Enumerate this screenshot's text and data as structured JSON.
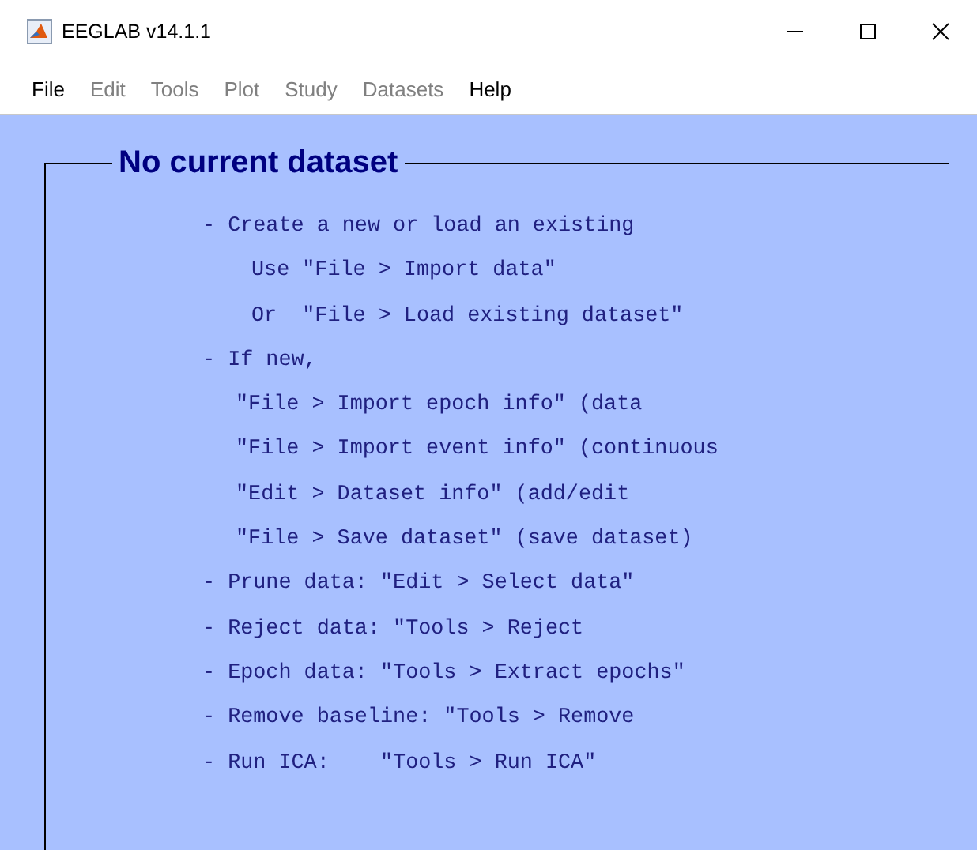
{
  "window": {
    "title": "EEGLAB v14.1.1"
  },
  "menu": [
    {
      "label": "File",
      "disabled": false
    },
    {
      "label": "Edit",
      "disabled": true
    },
    {
      "label": "Tools",
      "disabled": true
    },
    {
      "label": "Plot",
      "disabled": true
    },
    {
      "label": "Study",
      "disabled": true
    },
    {
      "label": "Datasets",
      "disabled": true
    },
    {
      "label": "Help",
      "disabled": false
    }
  ],
  "panel": {
    "title": "No current dataset",
    "lines": [
      {
        "kind": "bullet",
        "text": "- Create a new or load an existing"
      },
      {
        "kind": "option",
        "text": "Use \"File > Import data\""
      },
      {
        "kind": "option",
        "text": "Or  \"File > Load existing dataset\""
      },
      {
        "kind": "bullet",
        "text": "- If new,"
      },
      {
        "kind": "step",
        "text": "\"File > Import epoch info\" (data"
      },
      {
        "kind": "step",
        "text": "\"File > Import event info\" (continuous"
      },
      {
        "kind": "step",
        "text": "\"Edit > Dataset info\" (add/edit"
      },
      {
        "kind": "step",
        "text": "\"File > Save dataset\" (save dataset)"
      },
      {
        "kind": "bullet",
        "text": "- Prune data: \"Edit > Select data\""
      },
      {
        "kind": "bullet",
        "text": "- Reject data: \"Tools > Reject"
      },
      {
        "kind": "bullet",
        "text": "- Epoch data: \"Tools > Extract epochs\""
      },
      {
        "kind": "bullet",
        "text": "- Remove baseline: \"Tools > Remove"
      },
      {
        "kind": "bullet",
        "text": "- Run ICA:    \"Tools > Run ICA\""
      }
    ]
  }
}
